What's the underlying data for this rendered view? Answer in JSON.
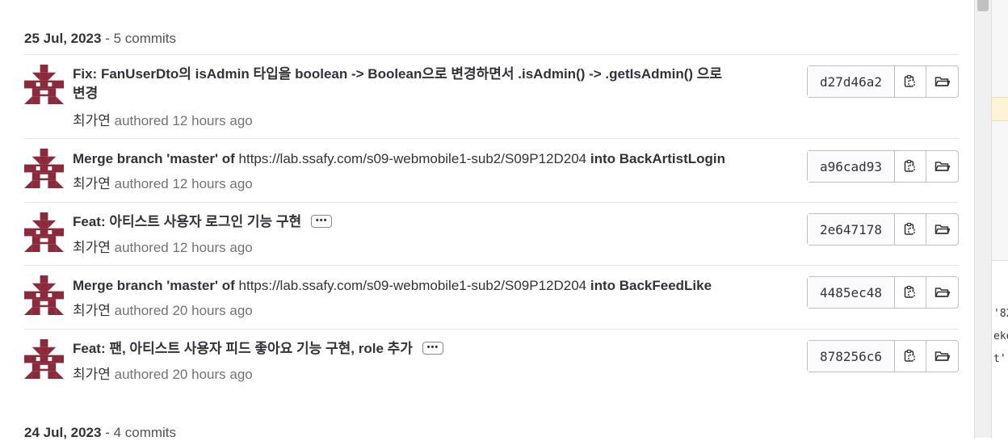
{
  "days": [
    {
      "date": "25 Jul, 2023",
      "count": " - 5 commits"
    },
    {
      "date": "24 Jul, 2023",
      "count": " - 4 commits"
    }
  ],
  "commits": [
    {
      "title_line1": "Fix: FanUserDto의 isAdmin 타입을 boolean -> Boolean으로 변경하면서 .isAdmin() -> .getIsAdmin() 으로",
      "title_line2": "변경",
      "author": "최가연",
      "authored": " authored 12 hours ago",
      "sha": "d27d46a2"
    },
    {
      "title_pre": "Merge branch 'master' of ",
      "title_link": "https://lab.ssafy.com/s09-webmobile1-sub2/S09P12D204",
      "title_post": " into BackArtistLogin",
      "author": "최가연",
      "authored": " authored 12 hours ago",
      "sha": "a96cad93"
    },
    {
      "title": "Feat: 아티스트 사용자 로그인 기능 구현",
      "ellipsis": "•••",
      "author": "최가연",
      "authored": " authored 12 hours ago",
      "sha": "2e647178"
    },
    {
      "title_pre": "Merge branch 'master' of ",
      "title_link": "https://lab.ssafy.com/s09-webmobile1-sub2/S09P12D204",
      "title_post": " into BackFeedLike",
      "author": "최가연",
      "authored": " authored 20 hours ago",
      "sha": "4485ec48"
    },
    {
      "title": "Feat: 팬, 아티스트 사용자 피드 좋아요 기능 구현, role 추가",
      "ellipsis": "•••",
      "author": "최가연",
      "authored": " authored 20 hours ago",
      "sha": "878256c6"
    }
  ],
  "icons": {
    "avatar": "identicon-avatar",
    "copy": "copy-icon",
    "browse": "folder-icon"
  },
  "colors": {
    "avatar": "#8b2a3b",
    "text": "#333238",
    "muted": "#737278",
    "border": "#bfbfc3",
    "highlight": "#fdf4d5"
  },
  "right_edge_snippets": [
    "'82",
    "eke",
    "t'"
  ]
}
